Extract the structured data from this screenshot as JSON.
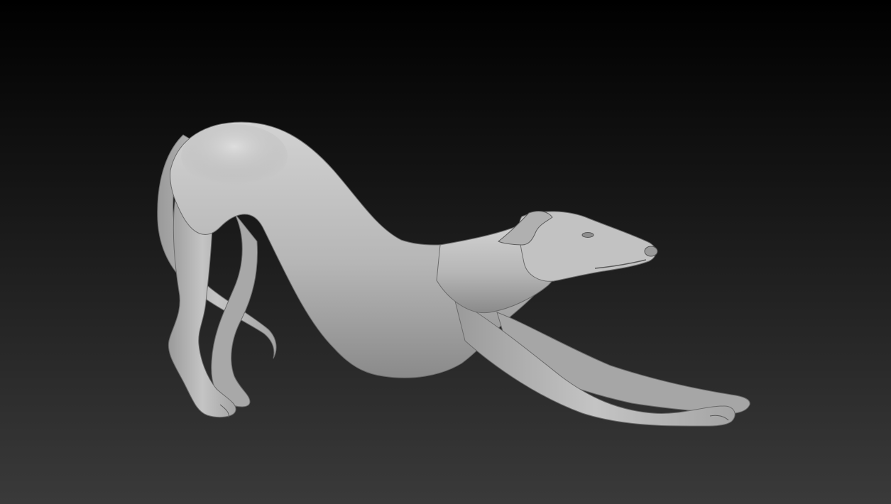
{
  "scene": {
    "subject": "greyhound-dog-sculpt",
    "pose": "play-bow-stretch",
    "material_color": "#b9b9b9",
    "background_top_color": "#000000",
    "background_bottom_color": "#3a3a3a"
  }
}
